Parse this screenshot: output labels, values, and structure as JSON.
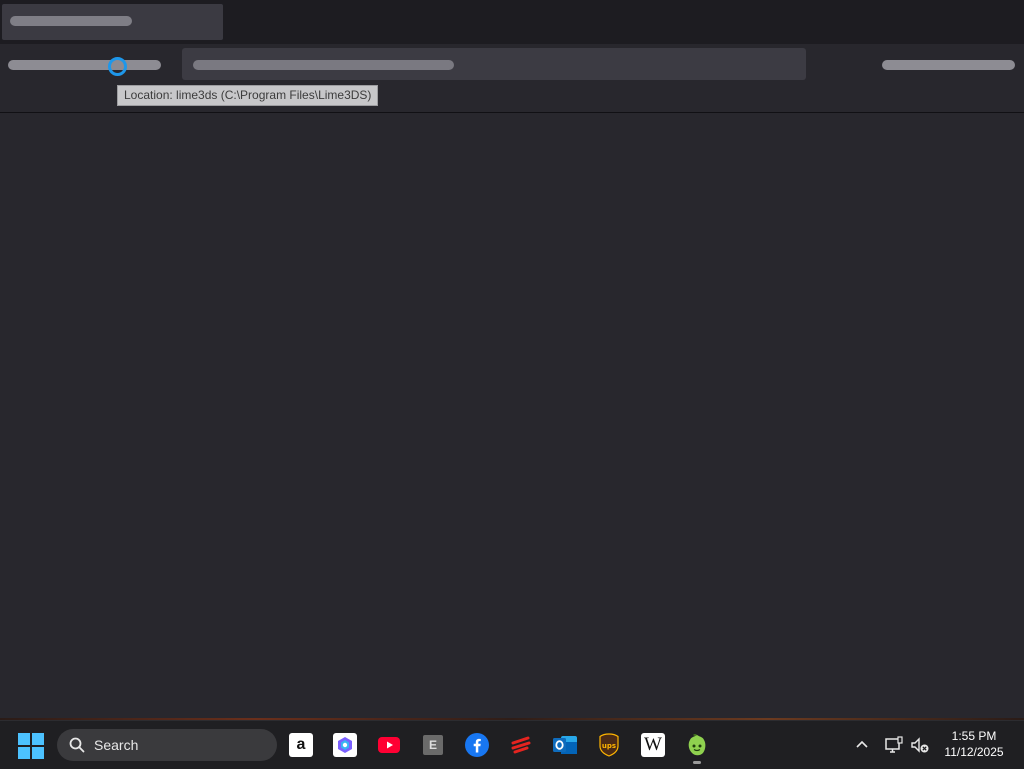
{
  "tooltip": {
    "text": "Location: lime3ds (C:\\Program Files\\Lime3DS)"
  },
  "taskbar": {
    "search_label": "Search",
    "apps": [
      {
        "name": "amazon",
        "glyph": "a"
      },
      {
        "name": "copilot"
      },
      {
        "name": "youtube"
      },
      {
        "name": "epic-games",
        "glyph": "E"
      },
      {
        "name": "facebook"
      },
      {
        "name": "bet"
      },
      {
        "name": "outlook"
      },
      {
        "name": "ups"
      },
      {
        "name": "wikipedia",
        "glyph": "W"
      },
      {
        "name": "lime3ds"
      }
    ],
    "clock": {
      "time": "1:55 PM",
      "date": "11/12/2025"
    }
  },
  "colors": {
    "background": "#28272d",
    "title_strip": "#1d1c21",
    "accent_blue": "#4cc2ff",
    "cursor_ring": "#1e97ea"
  }
}
